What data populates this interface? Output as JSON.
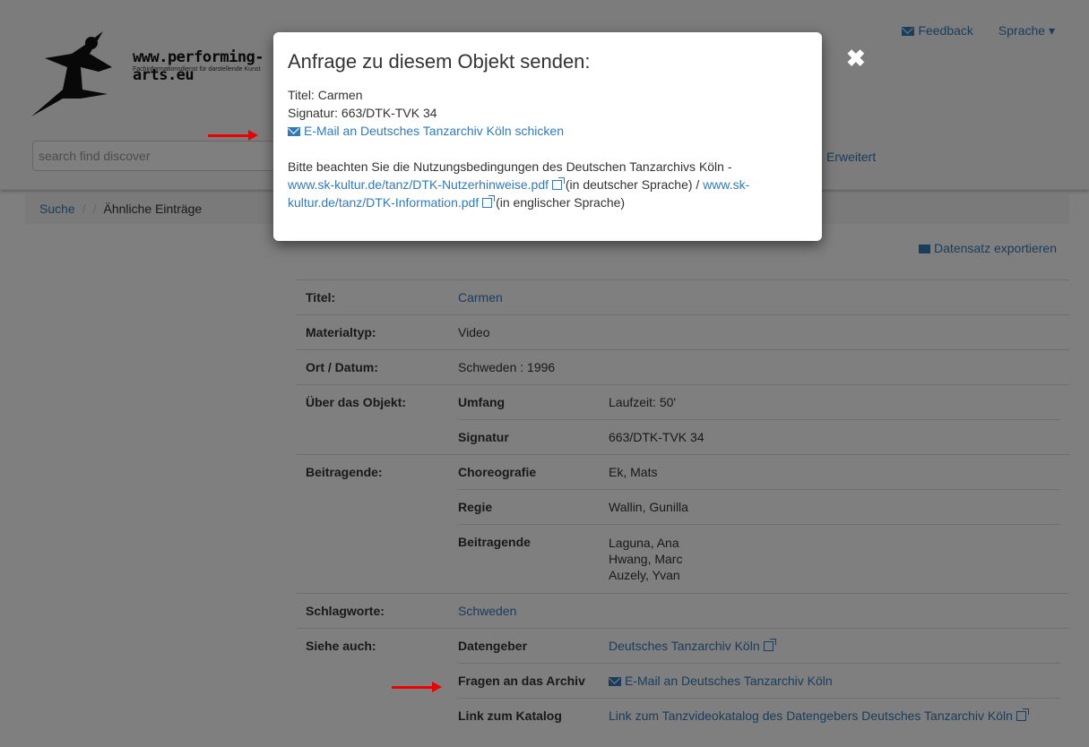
{
  "header": {
    "site_name": "www.performing-arts.eu",
    "tagline": "Fachinformationsdienst für darstellende Kunst",
    "feedback": "Feedback",
    "language": "Sprache",
    "search_placeholder": "search find discover",
    "advanced": "Erweitert"
  },
  "breadcrumb": {
    "items": [
      "Suche",
      "Ähnliche Einträge"
    ]
  },
  "export_label": "Datensatz exportieren",
  "record": {
    "titel_label": "Titel:",
    "titel_value": "Carmen",
    "materialtyp_label": "Materialtyp:",
    "materialtyp_value": "Video",
    "ort_label": "Ort / Datum:",
    "ort_value": "Schweden : 1996",
    "ueber_label": "Über das Objekt:",
    "umfang_label": "Umfang",
    "umfang_value": "Laufzeit: 50'",
    "signatur_label": "Signatur",
    "signatur_value": "663/DTK-TVK 34",
    "beitragende_label": "Beitragende:",
    "choreografie_label": "Choreografie",
    "choreografie_value": "Ek, Mats",
    "regie_label": "Regie",
    "regie_value": "Wallin, Gunilla",
    "beitragende_sub_label": "Beitragende",
    "beitragende_values": [
      "Laguna, Ana",
      "Hwang, Marc",
      "Auzely, Yvan"
    ],
    "schlagworte_label": "Schlagworte:",
    "schlagworte_value": "Schweden",
    "siehe_label": "Siehe auch:",
    "datengeber_label": "Datengeber",
    "datengeber_value": "Deutsches Tanzarchiv Köln",
    "fragen_label": "Fragen an das Archiv",
    "fragen_value": "E-Mail an Deutsches Tanzarchiv Köln",
    "katalog_label": "Link zum Katalog",
    "katalog_value": "Link zum Tanzvideokatalog des Datengebers Deutsches Tanzarchiv Köln"
  },
  "modal": {
    "title": "Anfrage zu diesem Objekt senden:",
    "titel_line": "Titel: Carmen",
    "signatur_line": "Signatur: 663/DTK-TVK 34",
    "email_link": "E-Mail an Deutsches Tanzarchiv Köln schicken",
    "notice_text": "Bitte beachten Sie die Nutzungsbedingungen des Deutschen Tanzarchivs Köln -",
    "link1": "www.sk-kultur.de/tanz/DTK-Nutzerhinweise.pdf",
    "link1_suffix": "(in deutscher Sprache) /",
    "link2_part1": "www.sk-",
    "link2_part2": "kultur.de/tanz/DTK-Information.pdf",
    "link2_suffix": "(in englischer Sprache)",
    "close_symbol": "✖"
  },
  "colors": {
    "link": "#337ab7",
    "annotation_arrow": "#ee0000"
  }
}
